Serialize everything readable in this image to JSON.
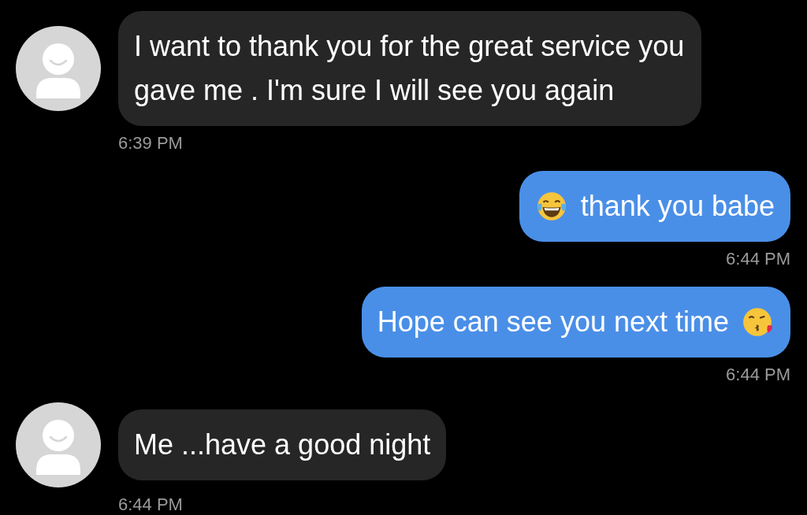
{
  "messages": [
    {
      "kind": "incoming",
      "parts": [
        {
          "kind": "text",
          "text": "I want to thank you for the great service you gave me . I'm sure I will see you again"
        }
      ],
      "time": "6:39 PM"
    },
    {
      "kind": "outgoing",
      "parts": [
        {
          "kind": "laughing_emoji"
        },
        {
          "kind": "text",
          "text": "thank you babe"
        }
      ],
      "time": "6:44 PM"
    },
    {
      "kind": "outgoing",
      "parts": [
        {
          "kind": "text",
          "text": "Hope can see you next time"
        },
        {
          "kind": "kiss_emoji"
        }
      ],
      "time": "6:44 PM"
    },
    {
      "kind": "incoming",
      "parts": [
        {
          "kind": "text",
          "text": "Me ...have a good night"
        }
      ],
      "time": "6:44 PM"
    }
  ]
}
